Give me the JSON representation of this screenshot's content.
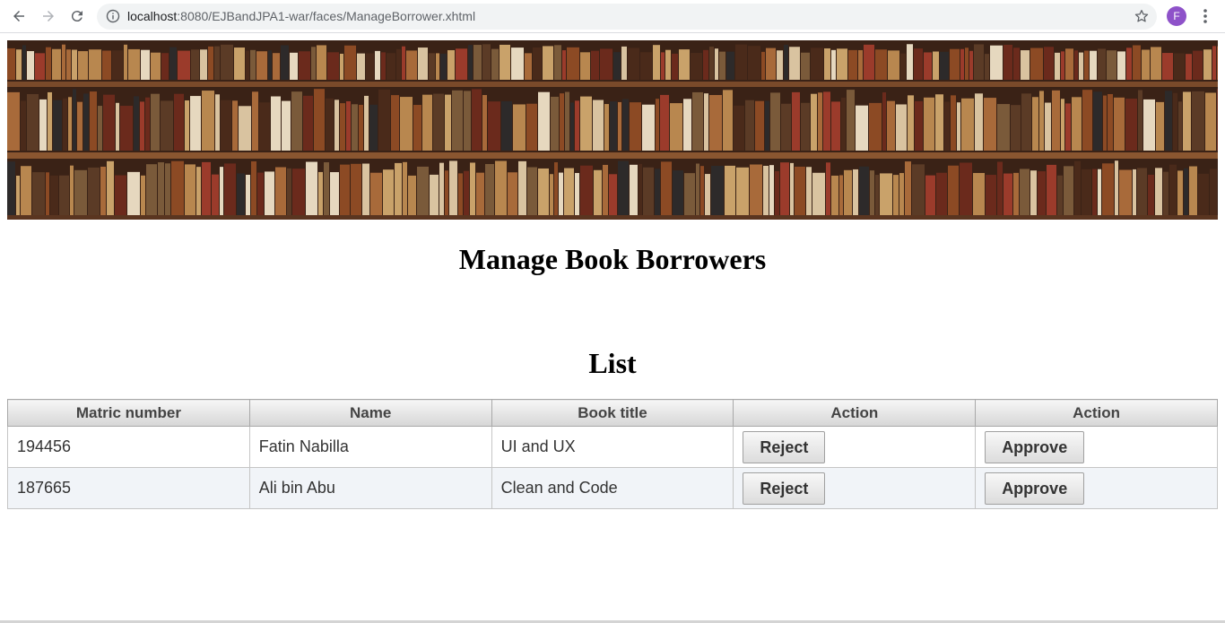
{
  "browser": {
    "url_host": "localhost",
    "url_path": ":8080/EJBandJPA1-war/faces/ManageBorrower.xhtml",
    "profile_initial": "F",
    "profile_color": "#8e52c9"
  },
  "page": {
    "title": "Manage Book Borrowers",
    "list_heading": "List"
  },
  "table": {
    "headers": [
      "Matric number",
      "Name",
      "Book title",
      "Action",
      "Action"
    ],
    "rows": [
      {
        "matric": "194456",
        "name": "Fatin Nabilla",
        "book": "UI and UX",
        "reject_label": "Reject",
        "approve_label": "Approve"
      },
      {
        "matric": "187665",
        "name": "Ali bin Abu",
        "book": "Clean and Code",
        "reject_label": "Reject",
        "approve_label": "Approve"
      }
    ]
  }
}
